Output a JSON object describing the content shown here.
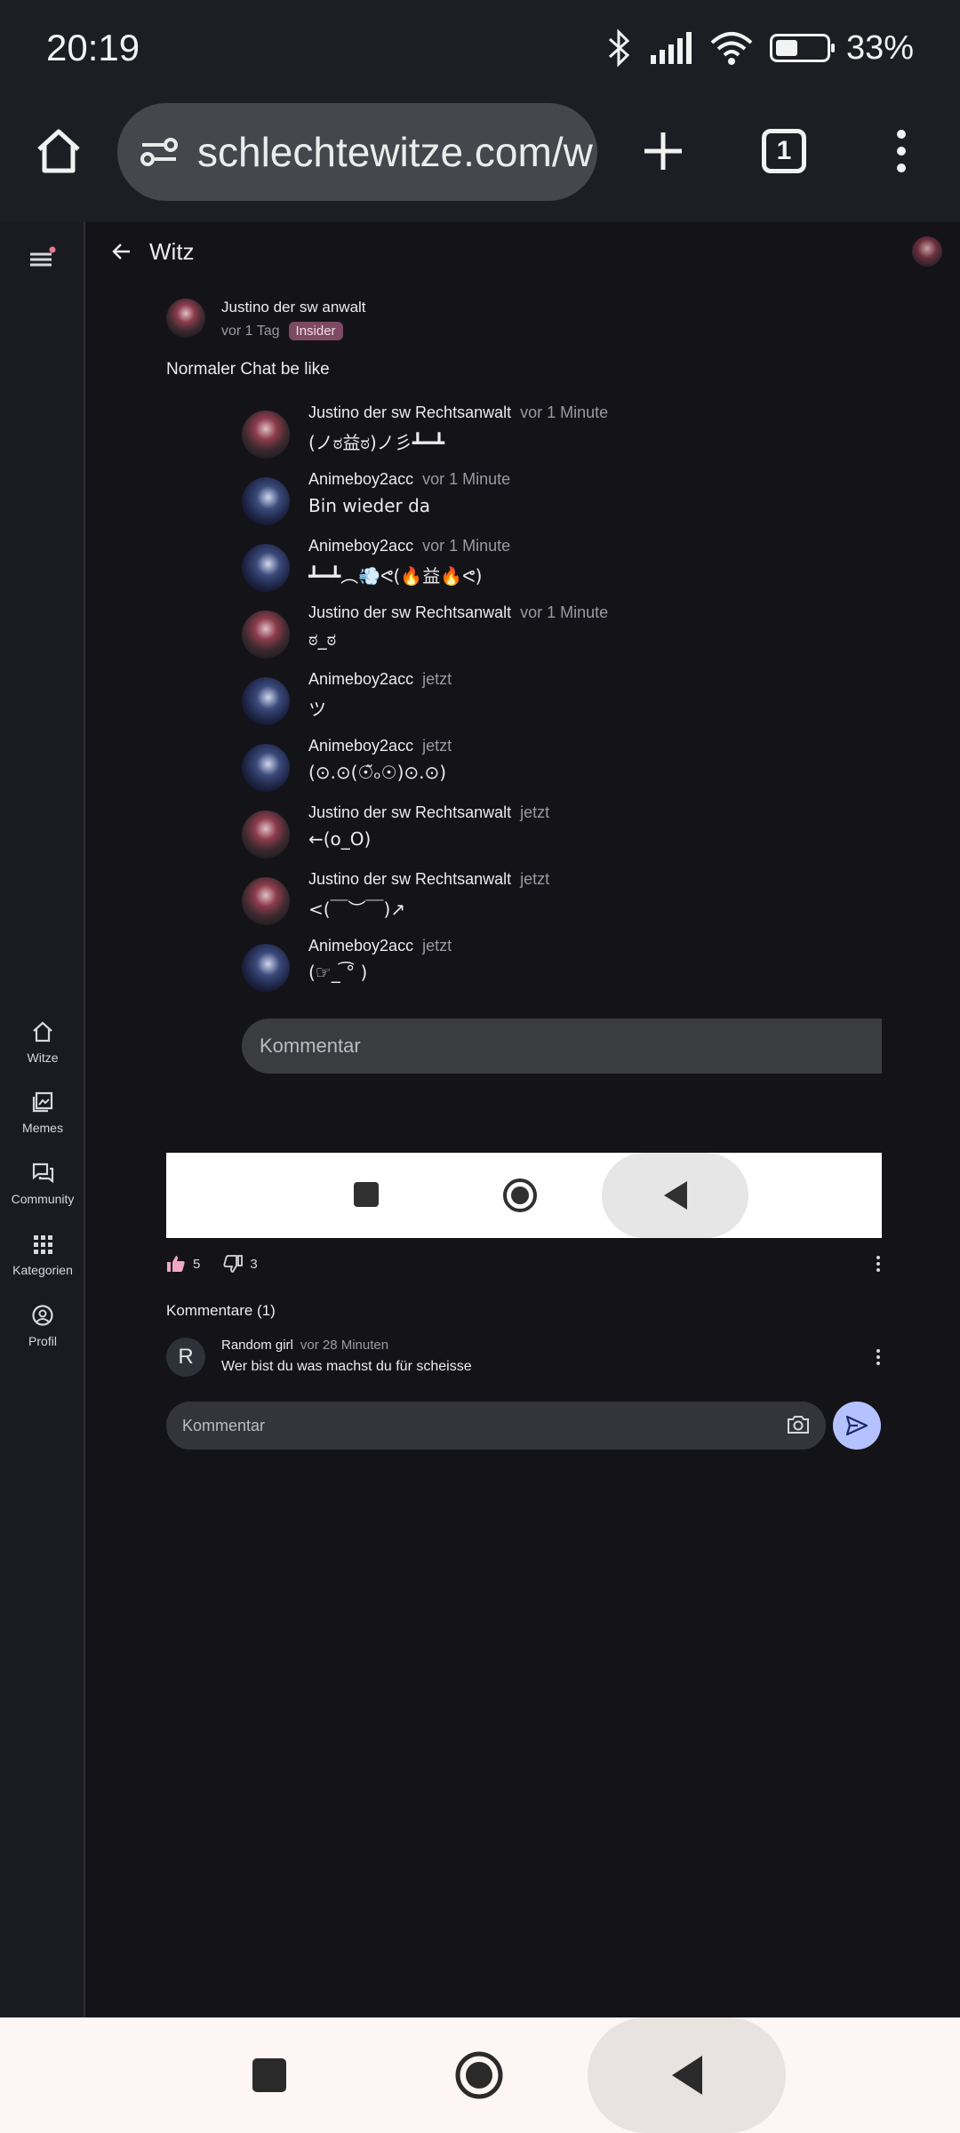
{
  "status_bar": {
    "time": "20:19",
    "battery_percent": "33%"
  },
  "browser": {
    "url": "schlechtewitze.com/w",
    "tab_count": "1"
  },
  "rail": {
    "items": [
      {
        "label": "Witze",
        "icon": "home-icon"
      },
      {
        "label": "Memes",
        "icon": "image-icon"
      },
      {
        "label": "Community",
        "icon": "forum-icon"
      },
      {
        "label": "Kategorien",
        "icon": "grid-icon"
      },
      {
        "label": "Profil",
        "icon": "account-icon"
      }
    ]
  },
  "header": {
    "title": "Witz"
  },
  "post": {
    "author": "Justino der sw anwalt",
    "time": "vor 1 Tag",
    "badge": "Insider",
    "text": "Normaler Chat be like"
  },
  "chat": {
    "messages": [
      {
        "name": "Justino der sw Rechtsanwalt",
        "time": "vor 1 Minute",
        "text": "(ノಠ益ಠ)ノ彡┻━┻",
        "avatar": "justino"
      },
      {
        "name": "Animeboy2acc",
        "time": "vor 1 Minute",
        "text": "Bin wieder da",
        "avatar": "anime"
      },
      {
        "name": "Animeboy2acc",
        "time": "vor 1 Minute",
        "text": "┻━┻︵💨ᕙ(🔥益🔥ᕙ)",
        "avatar": "anime"
      },
      {
        "name": "Justino der sw Rechtsanwalt",
        "time": "vor 1 Minute",
        "text": "ಠ_ಠ",
        "avatar": "justino"
      },
      {
        "name": "Animeboy2acc",
        "time": "jetzt",
        "text": "ツ",
        "avatar": "anime"
      },
      {
        "name": "Animeboy2acc",
        "time": "jetzt",
        "text": "(⊙.⊙(☉̃ₒ☉)⊙.⊙)",
        "avatar": "anime"
      },
      {
        "name": "Justino der sw Rechtsanwalt",
        "time": "jetzt",
        "text": "←(o_O)",
        "avatar": "justino"
      },
      {
        "name": "Justino der sw Rechtsanwalt",
        "time": "jetzt",
        "text": "<(￣︶￣)↗",
        "avatar": "justino"
      },
      {
        "name": "Animeboy2acc",
        "time": "jetzt",
        "text": "(☞_ ͡° )",
        "avatar": "anime"
      }
    ],
    "comment_placeholder": "Kommentar"
  },
  "actions": {
    "likes": "5",
    "dislikes": "3"
  },
  "comments": {
    "title": "Kommentare (1)",
    "items": [
      {
        "initial": "R",
        "name": "Random girl",
        "time": "vor 28 Minuten",
        "text": "Wer bist du was machst du für scheisse"
      }
    ],
    "input_placeholder": "Kommentar"
  },
  "colors": {
    "background": "#131318",
    "accent": "#b4c3ff",
    "badge": "#7c4a64",
    "like": "#f2a7c3"
  }
}
